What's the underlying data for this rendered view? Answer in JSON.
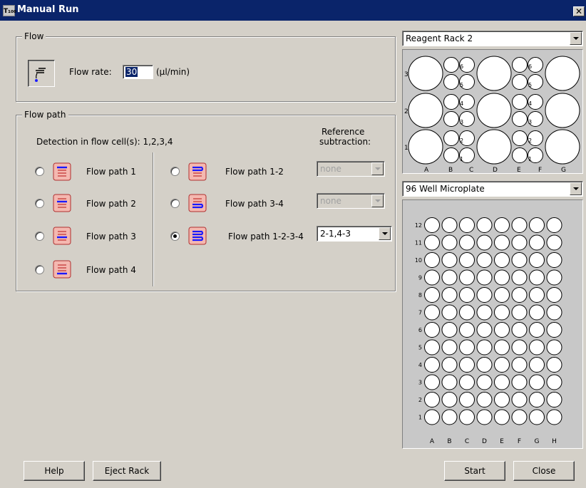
{
  "window": {
    "title": "Manual Run",
    "app_icon_text": "T₁₀₀",
    "close_glyph": "✕"
  },
  "flow": {
    "group_label": "Flow",
    "rate_label": "Flow rate:",
    "rate_value": "30",
    "rate_unit": "(µl/min)"
  },
  "flow_path": {
    "group_label": "Flow path",
    "detection_text": "Detection in flow cell(s): 1,2,3,4",
    "reference_header": [
      "Reference",
      "subtraction:"
    ],
    "single_paths": [
      {
        "label": "Flow path 1",
        "checked": false
      },
      {
        "label": "Flow path 2",
        "checked": false
      },
      {
        "label": "Flow path 3",
        "checked": false
      },
      {
        "label": "Flow path 4",
        "checked": false
      }
    ],
    "multi_paths": [
      {
        "label": "Flow path 1-2",
        "checked": false,
        "reference": "none",
        "enabled": false
      },
      {
        "label": "Flow path 3-4",
        "checked": false,
        "reference": "none",
        "enabled": false
      },
      {
        "label": "Flow path 1-2-3-4",
        "checked": true,
        "reference": "2-1,4-3",
        "enabled": true
      }
    ]
  },
  "reagent_rack": {
    "selected": "Reagent Rack 2",
    "row_labels": [
      "3",
      "2",
      "1"
    ],
    "column_labels": [
      "A",
      "B",
      "C",
      "D",
      "E",
      "F",
      "G"
    ],
    "small_labels": [
      "6",
      "5",
      "4",
      "3",
      "2",
      "1"
    ]
  },
  "microplate": {
    "selected": "96 Well Microplate",
    "row_labels": [
      "12",
      "11",
      "10",
      "9",
      "8",
      "7",
      "6",
      "5",
      "4",
      "3",
      "2",
      "1"
    ],
    "column_labels": [
      "A",
      "B",
      "C",
      "D",
      "E",
      "F",
      "G",
      "H"
    ]
  },
  "buttons": {
    "help": "Help",
    "eject": "Eject Rack",
    "start": "Start",
    "close": "Close"
  },
  "colors": {
    "titlebar": "#0a246a",
    "dialog": "#d4d0c8",
    "icon_fill": "#f4b8b0",
    "icon_line": "#1a1aff"
  }
}
